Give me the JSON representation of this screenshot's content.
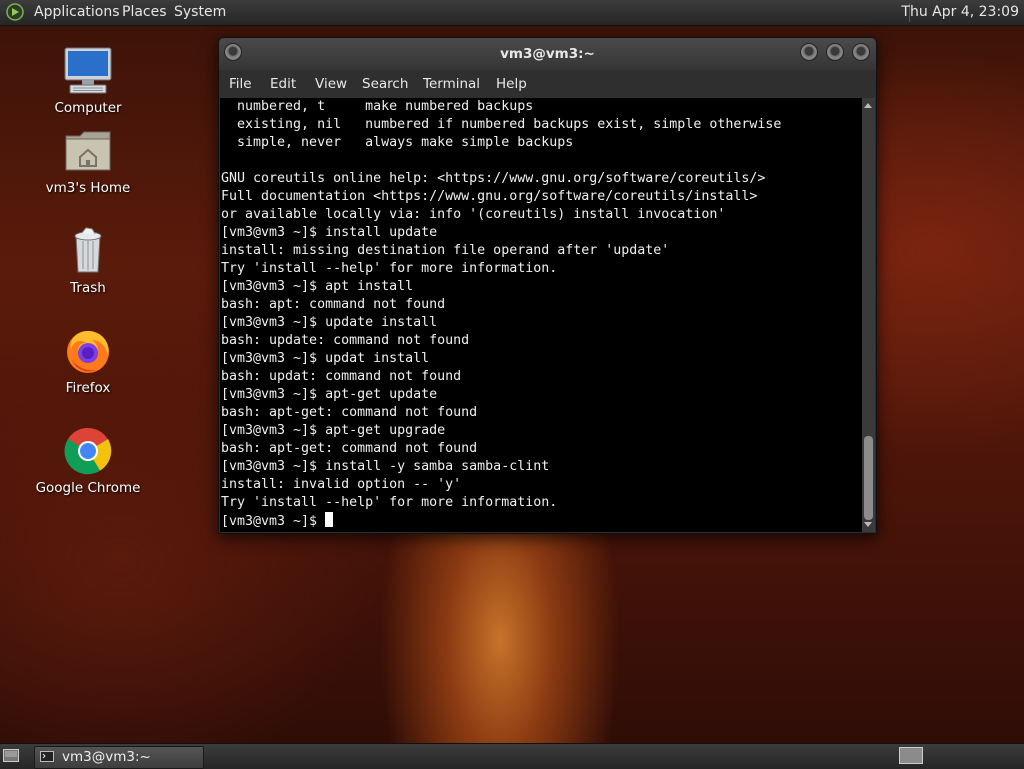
{
  "top_panel": {
    "menus": [
      "Applications",
      "Places",
      "System"
    ],
    "clock": "Thu Apr 4, 23:09"
  },
  "desktop_icons": [
    {
      "label": "Computer",
      "icon": "computer-icon"
    },
    {
      "label": "vm3's Home",
      "icon": "home-folder-icon"
    },
    {
      "label": "Trash",
      "icon": "trash-icon"
    },
    {
      "label": "Firefox",
      "icon": "firefox-icon"
    },
    {
      "label": "Google Chrome",
      "icon": "chrome-icon"
    }
  ],
  "window": {
    "title": "vm3@vm3:~",
    "menu": [
      "File",
      "Edit",
      "View",
      "Search",
      "Terminal",
      "Help"
    ],
    "terminal_lines": [
      "  numbered, t     make numbered backups",
      "  existing, nil   numbered if numbered backups exist, simple otherwise",
      "  simple, never   always make simple backups",
      "",
      "GNU coreutils online help: <https://www.gnu.org/software/coreutils/>",
      "Full documentation <https://www.gnu.org/software/coreutils/install>",
      "or available locally via: info '(coreutils) install invocation'",
      "[vm3@vm3 ~]$ install update",
      "install: missing destination file operand after 'update'",
      "Try 'install --help' for more information.",
      "[vm3@vm3 ~]$ apt install",
      "bash: apt: command not found",
      "[vm3@vm3 ~]$ update install",
      "bash: update: command not found",
      "[vm3@vm3 ~]$ updat install",
      "bash: updat: command not found",
      "[vm3@vm3 ~]$ apt-get update",
      "bash: apt-get: command not found",
      "[vm3@vm3 ~]$ apt-get upgrade",
      "bash: apt-get: command not found",
      "[vm3@vm3 ~]$ install -y samba samba-clint",
      "install: invalid option -- 'y'",
      "Try 'install --help' for more information."
    ],
    "prompt": "[vm3@vm3 ~]$ "
  },
  "bottom_panel": {
    "task_label": "vm3@vm3:~"
  }
}
